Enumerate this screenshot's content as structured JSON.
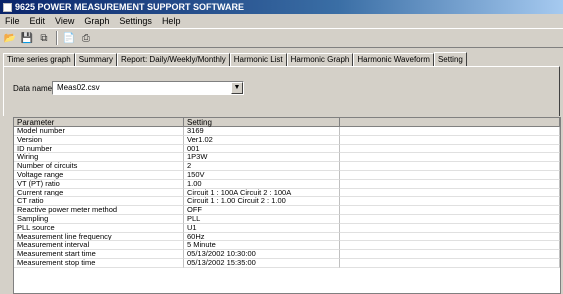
{
  "window": {
    "title": "9625 POWER MEASUREMENT SUPPORT SOFTWARE"
  },
  "menu": [
    "File",
    "Edit",
    "View",
    "Graph",
    "Settings",
    "Help"
  ],
  "toolbar": [
    "open-folder-icon",
    "save-icon",
    "copy-icon",
    "preview-icon",
    "print-icon"
  ],
  "tabs": [
    "Time series graph",
    "Summary",
    "Report: Daily/Weekly/Monthly",
    "Harmonic List",
    "Harmonic Graph",
    "Harmonic Waveform",
    "Setting"
  ],
  "active_tab": "Setting",
  "data_name": {
    "label": "Data name:",
    "value": "Meas02.csv"
  },
  "table": {
    "headers": [
      "Parameter",
      "Setting",
      ""
    ],
    "rows": [
      [
        "Model number",
        "3169"
      ],
      [
        "Version",
        "Ver1.02"
      ],
      [
        "ID number",
        "001"
      ],
      [
        "Wiring",
        "1P3W"
      ],
      [
        "Number of circuits",
        "2"
      ],
      [
        "Voltage range",
        "150V"
      ],
      [
        "VT (PT) ratio",
        "1.00"
      ],
      [
        "Current range",
        "Circuit 1 : 100A Circuit 2 : 100A"
      ],
      [
        "CT ratio",
        "Circuit 1 : 1.00 Circuit 2 : 1.00"
      ],
      [
        "Reactive power meter method",
        "OFF"
      ],
      [
        "Sampling",
        "PLL"
      ],
      [
        "PLL source",
        "U1"
      ],
      [
        "Measurement line frequency",
        "60Hz"
      ],
      [
        "Measurement interval",
        "5 Minute"
      ],
      [
        "Measurement start time",
        "05/13/2002 10:30:00"
      ],
      [
        "Measurement stop time",
        "05/13/2002 15:35:00"
      ]
    ]
  }
}
